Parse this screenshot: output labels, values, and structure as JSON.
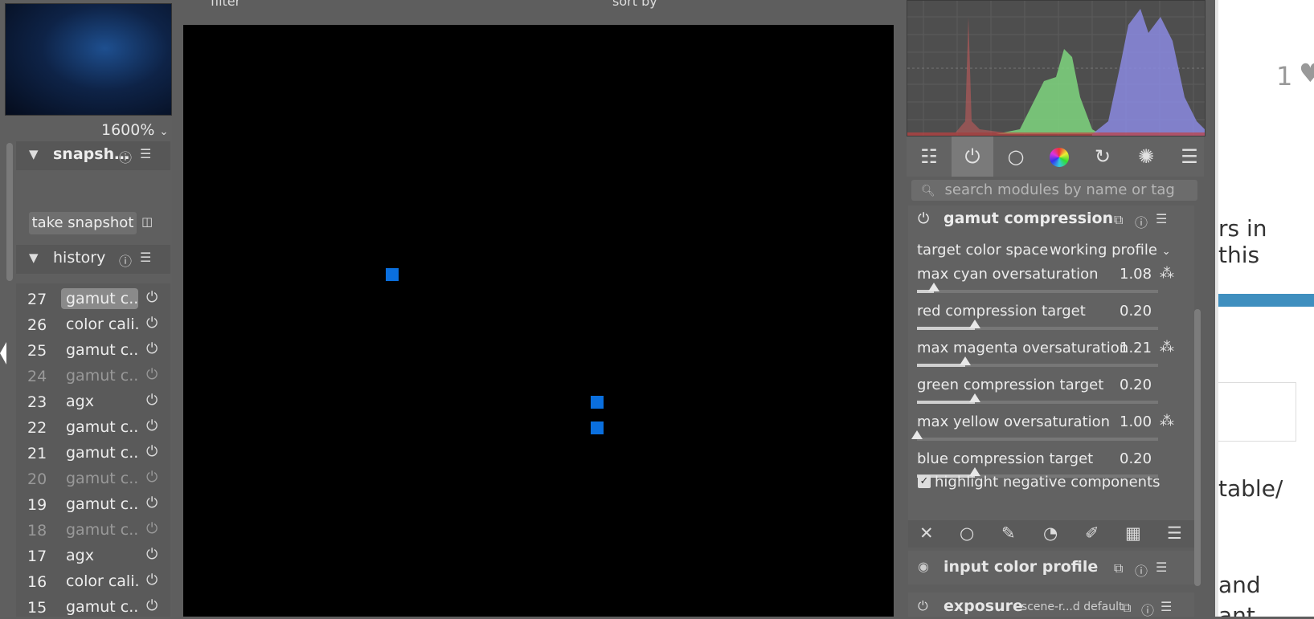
{
  "toolbar": {
    "filter_label": "filter",
    "sort_label": "sort by"
  },
  "left_panel": {
    "zoom": "1600%",
    "snapshots": {
      "title": "snapsh…",
      "take_button": "take snapshot",
      "compare_icon": "split-view-icon"
    },
    "history": {
      "title": "history",
      "items": [
        {
          "num": "27",
          "label": "gamut c...",
          "state": "selected"
        },
        {
          "num": "26",
          "label": "color cali...",
          "state": "on"
        },
        {
          "num": "25",
          "label": "gamut c...",
          "state": "on"
        },
        {
          "num": "24",
          "label": "gamut c...",
          "state": "off"
        },
        {
          "num": "23",
          "label": "agx",
          "state": "on"
        },
        {
          "num": "22",
          "label": "gamut c...",
          "state": "on"
        },
        {
          "num": "21",
          "label": "gamut c...",
          "state": "on"
        },
        {
          "num": "20",
          "label": "gamut c...",
          "state": "off"
        },
        {
          "num": "19",
          "label": "gamut c...",
          "state": "on"
        },
        {
          "num": "18",
          "label": "gamut c...",
          "state": "off"
        },
        {
          "num": "17",
          "label": "agx",
          "state": "on"
        },
        {
          "num": "16",
          "label": "color cali...",
          "state": "on"
        },
        {
          "num": "15",
          "label": "gamut c...",
          "state": "on"
        }
      ]
    }
  },
  "right_panel": {
    "search_placeholder": "search modules by name or tag",
    "module_tabs": [
      "sliders-icon",
      "power-icon",
      "circle-icon",
      "color-wheel-icon",
      "refresh-icon",
      "effects-icon",
      "menu-icon"
    ],
    "gamut_module": {
      "title": "gamut compression",
      "target_label": "target color space",
      "target_value": "working profile",
      "params": [
        {
          "label": "max cyan oversaturation",
          "value": "1.08",
          "fraction": 0.07,
          "wand": true
        },
        {
          "label": "red compression target",
          "value": "0.20",
          "fraction": 0.24,
          "wand": false
        },
        {
          "label": "max magenta oversaturation",
          "value": "1.21",
          "fraction": 0.2,
          "wand": true
        },
        {
          "label": "green compression target",
          "value": "0.20",
          "fraction": 0.24,
          "wand": false
        },
        {
          "label": "max yellow oversaturation",
          "value": "1.00",
          "fraction": 0.0,
          "wand": true
        },
        {
          "label": "blue compression target",
          "value": "0.20",
          "fraction": 0.24,
          "wand": false
        }
      ],
      "checkbox_label": "highlight negative components",
      "checkbox_checked": true
    },
    "input_color_profile": "input color profile",
    "exposure": {
      "title": "exposure",
      "subtitle": "· scene-r...d default"
    }
  },
  "browser": {
    "number": "1",
    "text1": "rs in this",
    "text2": "table/",
    "text3": "and",
    "text4": "ant"
  },
  "colors": {
    "accent_blue": "#0a6fde",
    "canvas": "#000000"
  }
}
